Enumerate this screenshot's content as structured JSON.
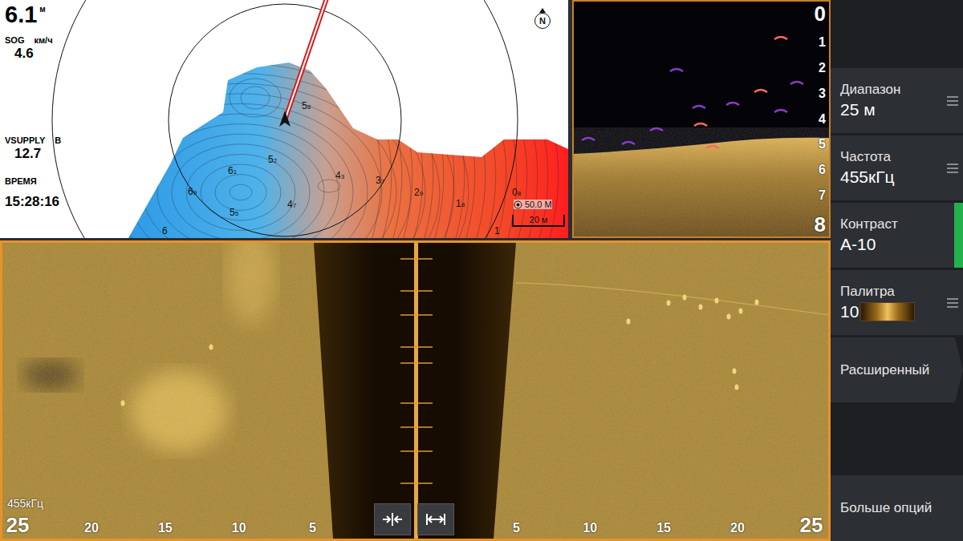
{
  "map": {
    "depth": {
      "value": "6.1",
      "unit": "м"
    },
    "readouts": [
      {
        "label": "SOG",
        "unit": "км/ч",
        "value": "4.6"
      },
      {
        "label": "VSUPPLY",
        "unit": "В",
        "value": "12.7"
      },
      {
        "label": "ВРЕМЯ",
        "value": "15:28:16"
      }
    ],
    "compass": "N",
    "range_ring": "50.0 М",
    "scale": "20 м",
    "soundings": [
      {
        "value": "5",
        "sub": "8"
      },
      {
        "value": "5",
        "sub": "2"
      },
      {
        "value": "6",
        "sub": "1"
      },
      {
        "value": "4",
        "sub": "3"
      },
      {
        "value": "3",
        "sub": "7"
      },
      {
        "value": "6",
        "sub": "9"
      },
      {
        "value": "4",
        "sub": "7"
      },
      {
        "value": "5",
        "sub": "5"
      },
      {
        "value": "2",
        "sub": "9"
      },
      {
        "value": "1",
        "sub": "8"
      },
      {
        "value": "0",
        "sub": "8"
      },
      {
        "value": "6"
      },
      {
        "value": "1"
      }
    ]
  },
  "sonar": {
    "depth_scale": [
      "0",
      "1",
      "2",
      "3",
      "4",
      "5",
      "6",
      "7",
      "8"
    ]
  },
  "side_scan": {
    "frequency": "455кГц",
    "scale": [
      "25",
      "20",
      "15",
      "10",
      "5",
      "5",
      "10",
      "15",
      "20",
      "25"
    ]
  },
  "menu": {
    "items": [
      {
        "label": "Диапазон",
        "value": "25 м",
        "kind": "value",
        "selected": false
      },
      {
        "label": "Частота",
        "value": "455кГц",
        "kind": "value",
        "selected": false
      },
      {
        "label": "Контраст",
        "value": "A-10",
        "kind": "value",
        "selected": true
      },
      {
        "label": "Палитра",
        "value": "10",
        "kind": "palette",
        "selected": false
      },
      {
        "label": "Расширенный",
        "kind": "submenu",
        "selected": false
      }
    ],
    "footer": "Больше опций"
  }
}
